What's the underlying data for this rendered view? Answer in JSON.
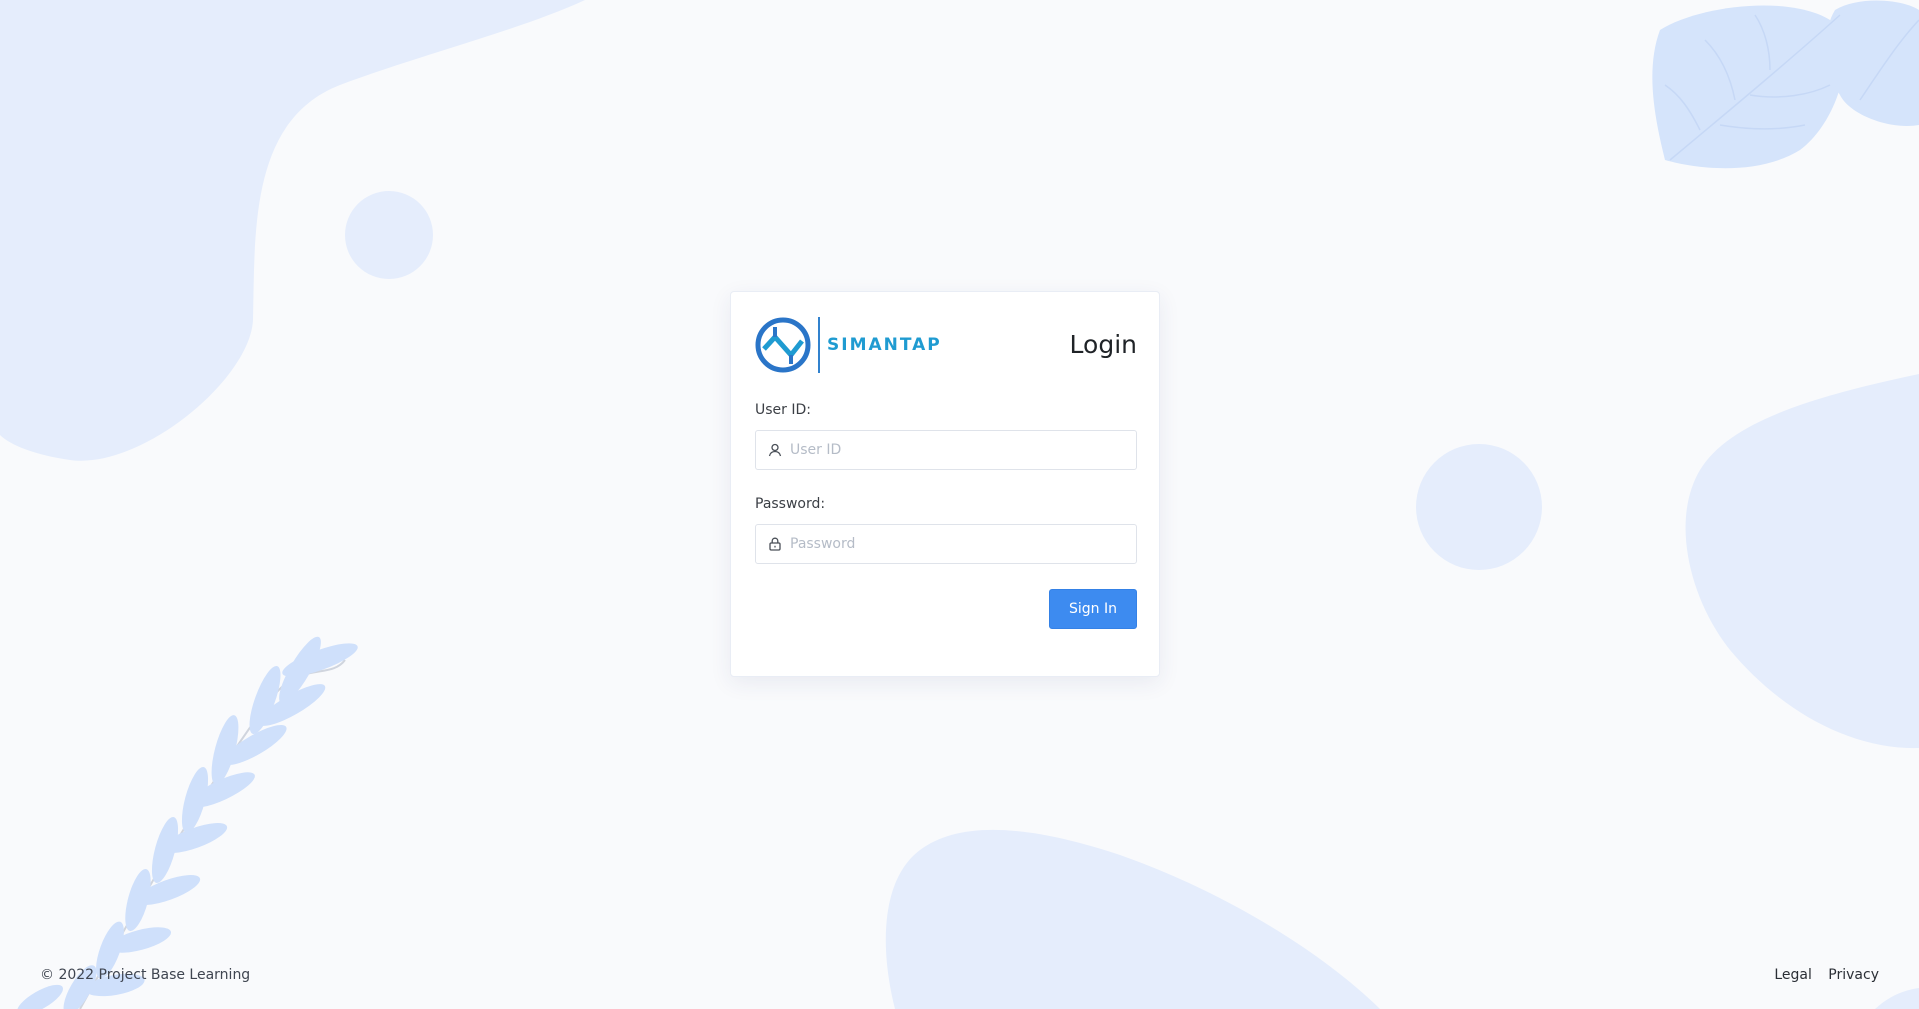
{
  "brand": {
    "name": "SIMANTAP",
    "colors": {
      "primary": "#3d8bf0",
      "logo_text": "#1f9bd1",
      "decor": "#e5edfc"
    }
  },
  "login": {
    "title": "Login",
    "user_id_label": "User ID:",
    "user_id_placeholder": "User ID",
    "user_id_icon": "user-icon",
    "password_label": "Password:",
    "password_placeholder": "Password",
    "password_icon": "lock-icon",
    "signin_label": "Sign In"
  },
  "footer": {
    "copyright": "© 2022 Project Base Learning",
    "links": {
      "legal": "Legal",
      "privacy": "Privacy"
    }
  }
}
